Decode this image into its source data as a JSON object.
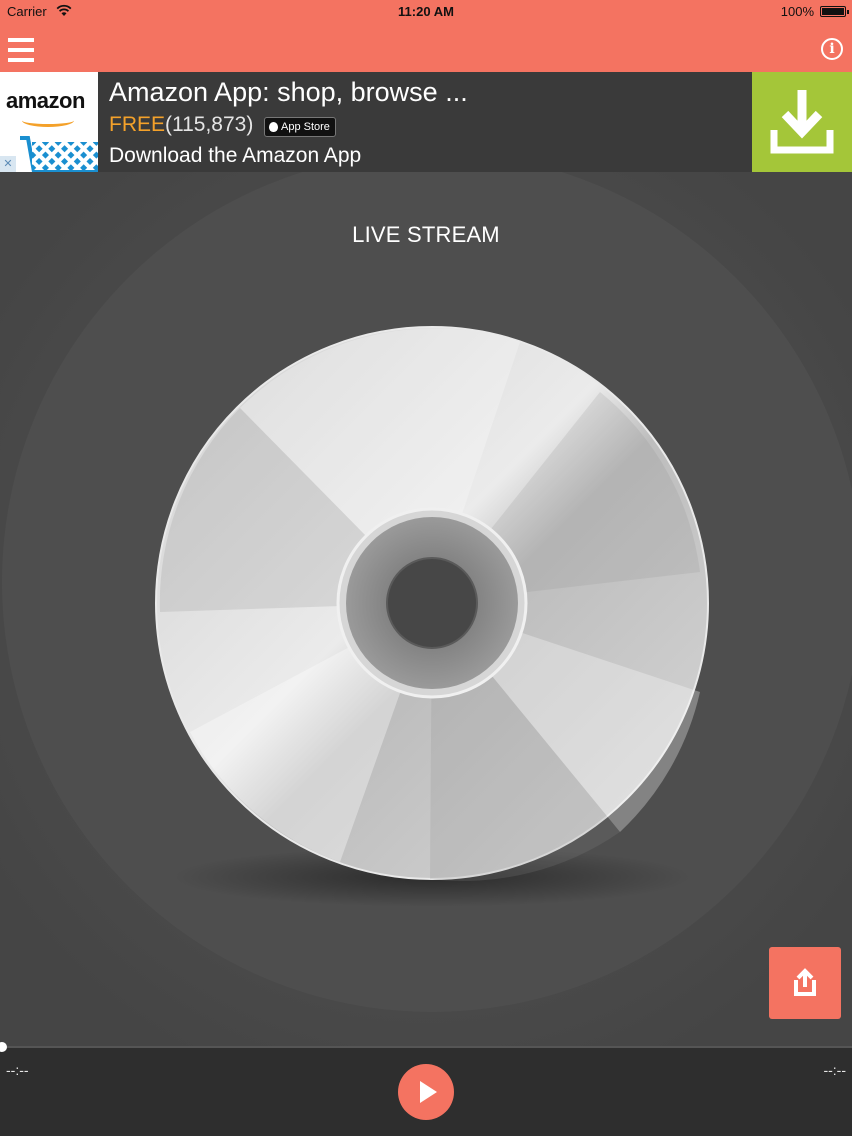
{
  "status_bar": {
    "carrier": "Carrier",
    "time": "11:20 AM",
    "battery_percent": "100%",
    "icons": [
      "wifi-icon",
      "battery-icon"
    ]
  },
  "nav_bar": {
    "left_icon": "menu-icon",
    "right_icon": "info-icon",
    "info_glyph": "i",
    "background": "#f47361"
  },
  "ad": {
    "brand_logo_text": "amazon",
    "title": "Amazon App: shop, browse ...",
    "price": "FREE",
    "rating_count": "(115,873)",
    "store_badge": "App Store",
    "subtitle": "Download the Amazon App",
    "download_icon": "download-icon",
    "adchoices_glyph": "✕",
    "download_color": "#a4c639"
  },
  "main": {
    "title": "LIVE STREAM",
    "artwork_icon": "cd-disc-icon",
    "share_icon": "share-icon"
  },
  "player": {
    "elapsed": "--:--",
    "remaining": "--:--",
    "progress": 0,
    "play_icon": "play-icon"
  }
}
